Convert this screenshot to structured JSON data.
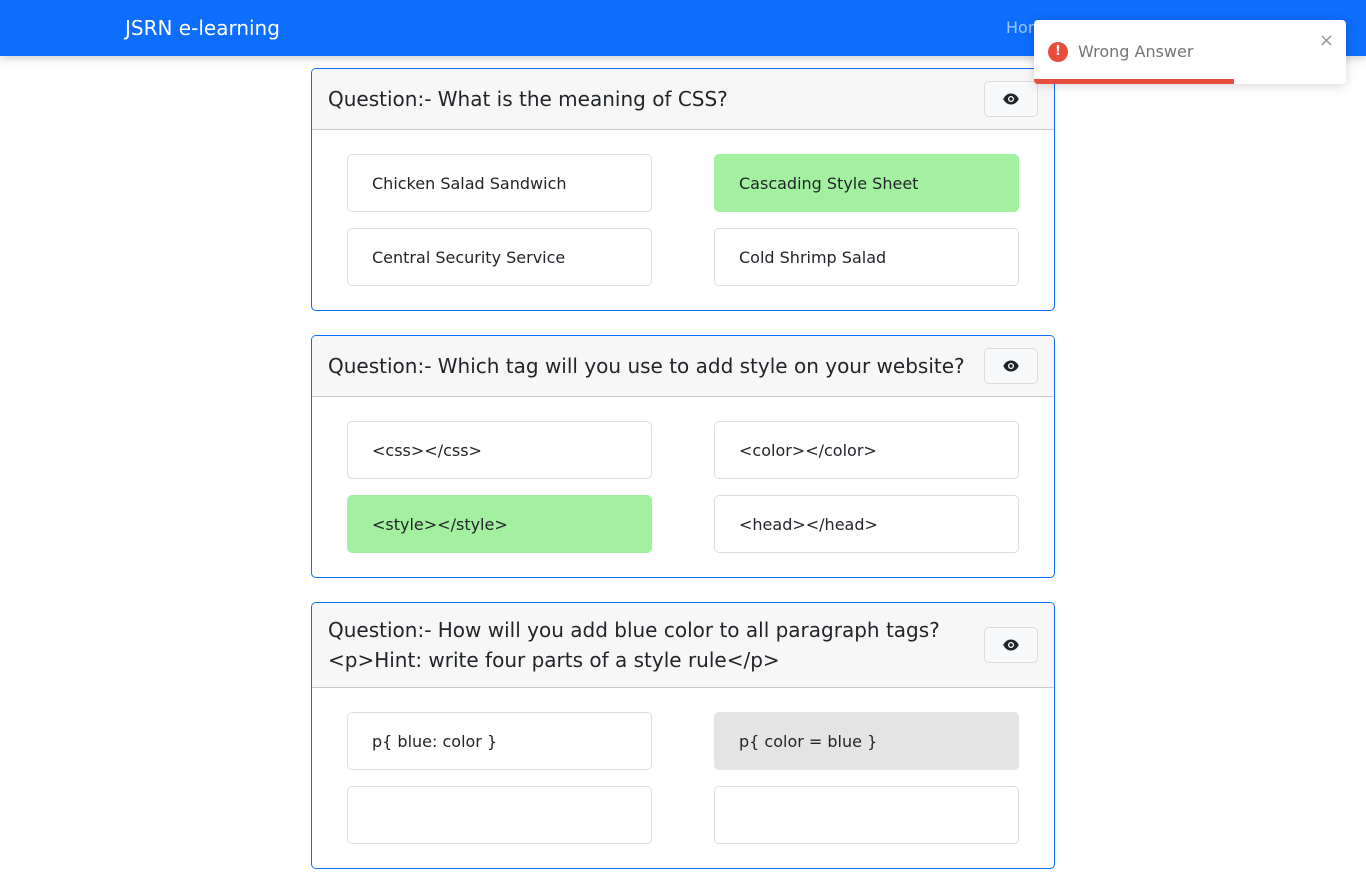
{
  "navbar": {
    "brand": "JSRN e-learning",
    "home_link": "Hom"
  },
  "questions": [
    {
      "text": "Question:- What is the meaning of CSS?",
      "options": [
        {
          "label": "Chicken Salad Sandwich",
          "state": "default"
        },
        {
          "label": "Cascading Style Sheet",
          "state": "correct"
        },
        {
          "label": "Central Security Service",
          "state": "default"
        },
        {
          "label": "Cold Shrimp Salad",
          "state": "default"
        }
      ]
    },
    {
      "text": "Question:- Which tag will you use to add style on your website?",
      "options": [
        {
          "label": "<css></css>",
          "state": "default"
        },
        {
          "label": "<color></color>",
          "state": "default"
        },
        {
          "label": "<style></style>",
          "state": "correct"
        },
        {
          "label": "<head></head>",
          "state": "default"
        }
      ]
    },
    {
      "text": "Question:- How will you add blue color to all paragraph tags?<p>Hint: write four parts of a style rule</p>",
      "options": [
        {
          "label": "p{ blue: color }",
          "state": "default"
        },
        {
          "label": "p{ color = blue }",
          "state": "selected"
        },
        {
          "label": "",
          "state": "default"
        },
        {
          "label": "",
          "state": "default"
        }
      ]
    }
  ],
  "toast": {
    "message": "Wrong Answer",
    "close_symbol": "×",
    "alert_symbol": "!",
    "progress": 0.64
  },
  "icons": {
    "reveal_answer": "eye-icon",
    "toast_alert": "error-icon",
    "toast_close": "close-icon"
  },
  "colors": {
    "navbar": "#0d6efd",
    "card_border": "#0d6efd",
    "correct_option": "#a3f1a0",
    "selected_option": "#e4e4e4",
    "error": "#e74c3c"
  }
}
